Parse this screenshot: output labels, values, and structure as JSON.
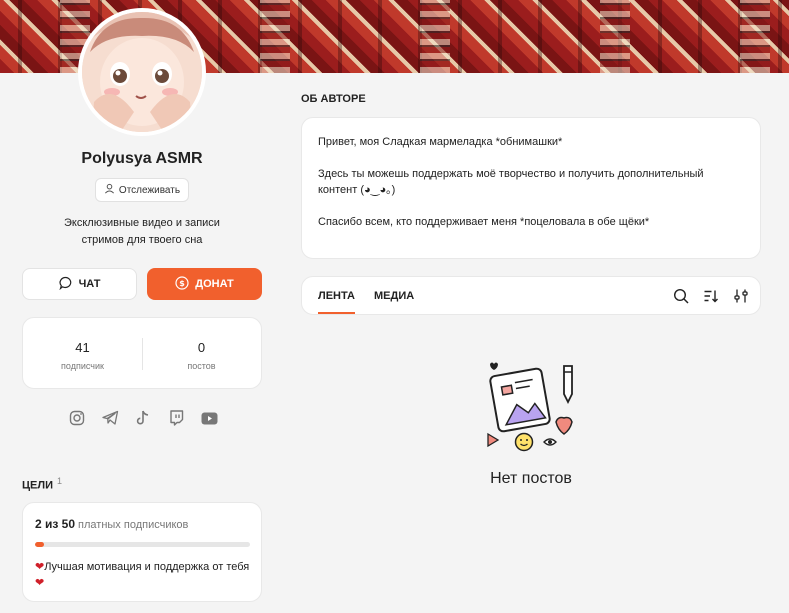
{
  "profile": {
    "name": "Polyusya ASMR",
    "follow_label": "Отслеживать",
    "description_line1": "Эксклюзивные видео и записи",
    "description_line2": "стримов для твоего сна"
  },
  "actions": {
    "chat_label": "ЧАТ",
    "donate_label": "ДОНАТ"
  },
  "stats": {
    "subscribers_count": "41",
    "subscribers_label": "подписчик",
    "posts_count": "0",
    "posts_label": "постов"
  },
  "socials": [
    "instagram-icon",
    "telegram-icon",
    "tiktok-icon",
    "twitch-icon",
    "youtube-icon"
  ],
  "goals": {
    "title": "ЦЕЛИ",
    "count": "1",
    "current": "2 из 50",
    "unit": "платных подписчиков",
    "progress_fraction": 0.04,
    "text": "Лучшая мотивация и поддержка от тебя"
  },
  "about": {
    "title": "ОБ АВТОРЕ",
    "line1": "Привет, моя Сладкая мармеладка *обнимашки*",
    "line2": "Здесь ты можешь поддержать моё творчество и получить дополнительный контент (◕‿◕｡)",
    "line3": "Спасибо всем, кто поддерживает меня *поцеловала в обе щёки*"
  },
  "tabs": {
    "feed_label": "ЛЕНТА",
    "media_label": "МЕДИА"
  },
  "empty": {
    "text": "Нет постов"
  },
  "colors": {
    "accent": "#f1602d",
    "background": "#f4f4f4",
    "card": "#ffffff"
  }
}
